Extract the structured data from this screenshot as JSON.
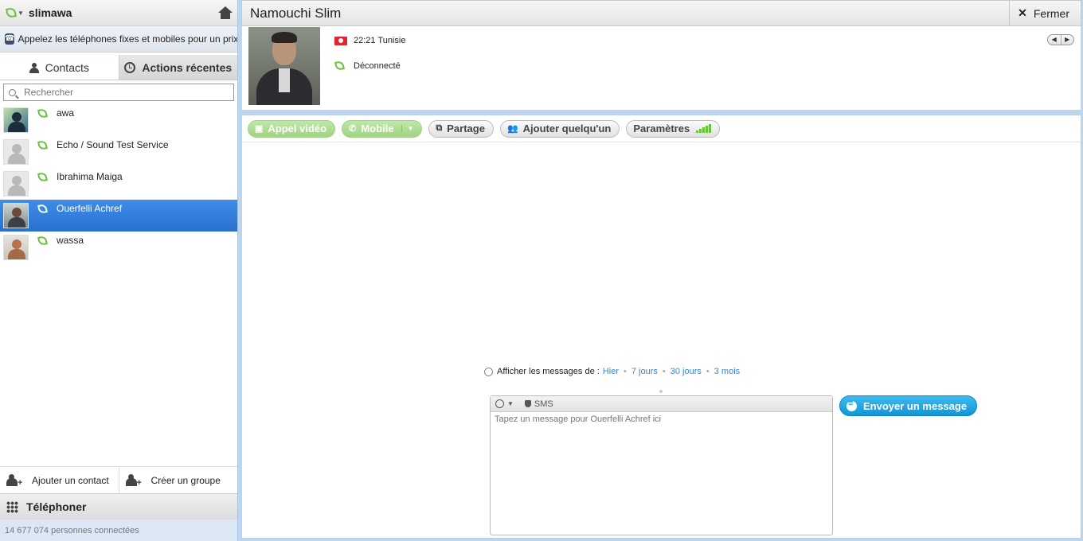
{
  "profile": {
    "username": "slimawa"
  },
  "promo": {
    "text": "Appelez les téléphones fixes et mobiles pour un prix..."
  },
  "tabs": {
    "contacts": "Contacts",
    "recent": "Actions récentes"
  },
  "search": {
    "placeholder": "Rechercher"
  },
  "contacts": [
    {
      "name": "awa",
      "status": "online",
      "selected": false
    },
    {
      "name": "Echo / Sound Test Service",
      "status": "online",
      "selected": false
    },
    {
      "name": "Ibrahima Maiga",
      "status": "online",
      "selected": false
    },
    {
      "name": "Ouerfelli Achref",
      "status": "online",
      "selected": true
    },
    {
      "name": "wassa",
      "status": "online",
      "selected": false
    }
  ],
  "left_actions": {
    "add_contact": "Ajouter un contact",
    "create_group": "Créer un groupe"
  },
  "phone": {
    "label": "Téléphoner"
  },
  "status_bar": {
    "text": "14 677 074 personnes connectées"
  },
  "conversation": {
    "contact_name": "Namouchi Slim",
    "close_label": "Fermer",
    "local_time": "22:21 Tunisie",
    "presence": "Déconnecté"
  },
  "toolbar": {
    "video_call": "Appel vidéo",
    "mobile": "Mobile",
    "share": "Partage",
    "add_someone": "Ajouter quelqu'un",
    "settings": "Paramètres"
  },
  "history": {
    "label": "Afficher les messages de :",
    "options": [
      "Hier",
      "7 jours",
      "30 jours",
      "3 mois"
    ]
  },
  "composer": {
    "sms_label": "SMS",
    "placeholder": "Tapez un message pour Ouerfelli Achref ici",
    "send_label": "Envoyer un message"
  },
  "colors": {
    "accent_blue": "#2a6fcf",
    "online_green": "#6cc23e",
    "send_blue": "#1296d8"
  }
}
